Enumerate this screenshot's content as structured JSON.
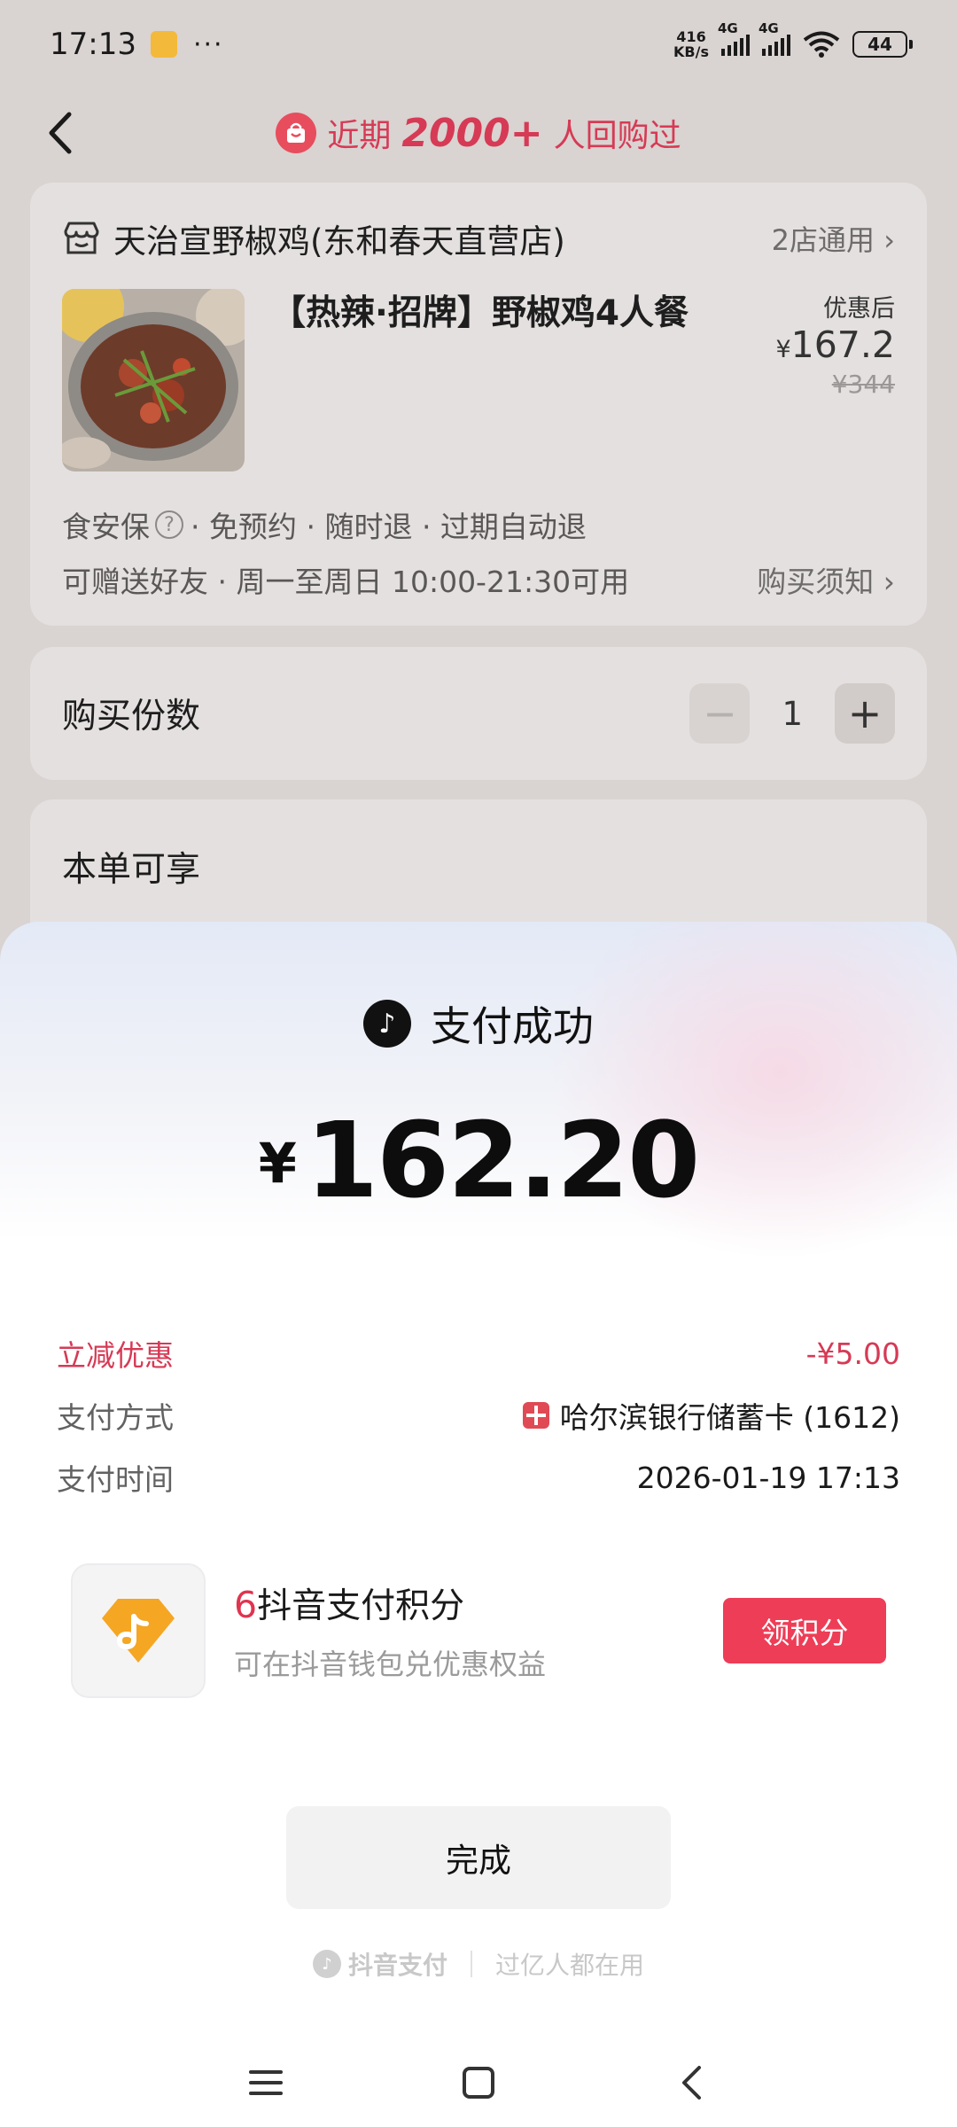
{
  "status_bar": {
    "time": "17:13",
    "more": "···",
    "net_speed_value": "416",
    "net_speed_unit": "KB/s",
    "signal1_label": "4G",
    "signal2_label": "4G",
    "battery": "44"
  },
  "header": {
    "banner_prefix": "近期",
    "banner_number": "2000+",
    "banner_suffix": "人回购过"
  },
  "order": {
    "store_name": "天治宣野椒鸡(东和春天直营店)",
    "store_link": "2店通用",
    "product_title": "【热辣·招牌】野椒鸡4人餐",
    "price_after_label": "优惠后¥",
    "price_after_value": "167.2",
    "price_original": "¥344",
    "tag_guarantee": "食安保",
    "tags_rest": "· 免预约 · 随时退 · 过期自动退",
    "tags_line2": "可赠送好友 · 周一至周日 10:00-21:30可用",
    "notice_link": "购买须知"
  },
  "quantity": {
    "label": "购买份数",
    "minus": "−",
    "value": "1",
    "plus": "+"
  },
  "benefits": {
    "label": "本单可享"
  },
  "payment_sheet": {
    "title": "支付成功",
    "currency": "¥",
    "amount": "162.20",
    "rows": [
      {
        "label": "立减优惠",
        "value": "-¥5.00"
      },
      {
        "label": "支付方式",
        "value": "哈尔滨银行储蓄卡 (1612)"
      },
      {
        "label": "支付时间",
        "value": "2026-01-19 17:13"
      }
    ],
    "points": {
      "count": "6",
      "title": "抖音支付积分",
      "subtitle": "可在抖音钱包兑优惠权益",
      "button": "领积分"
    },
    "done_button": "完成",
    "brand": "抖音支付",
    "slogan": "过亿人都在用"
  },
  "colors": {
    "accent_red": "#ee3d57",
    "discount_red": "#d63a55",
    "points_orange": "#f5a623"
  }
}
